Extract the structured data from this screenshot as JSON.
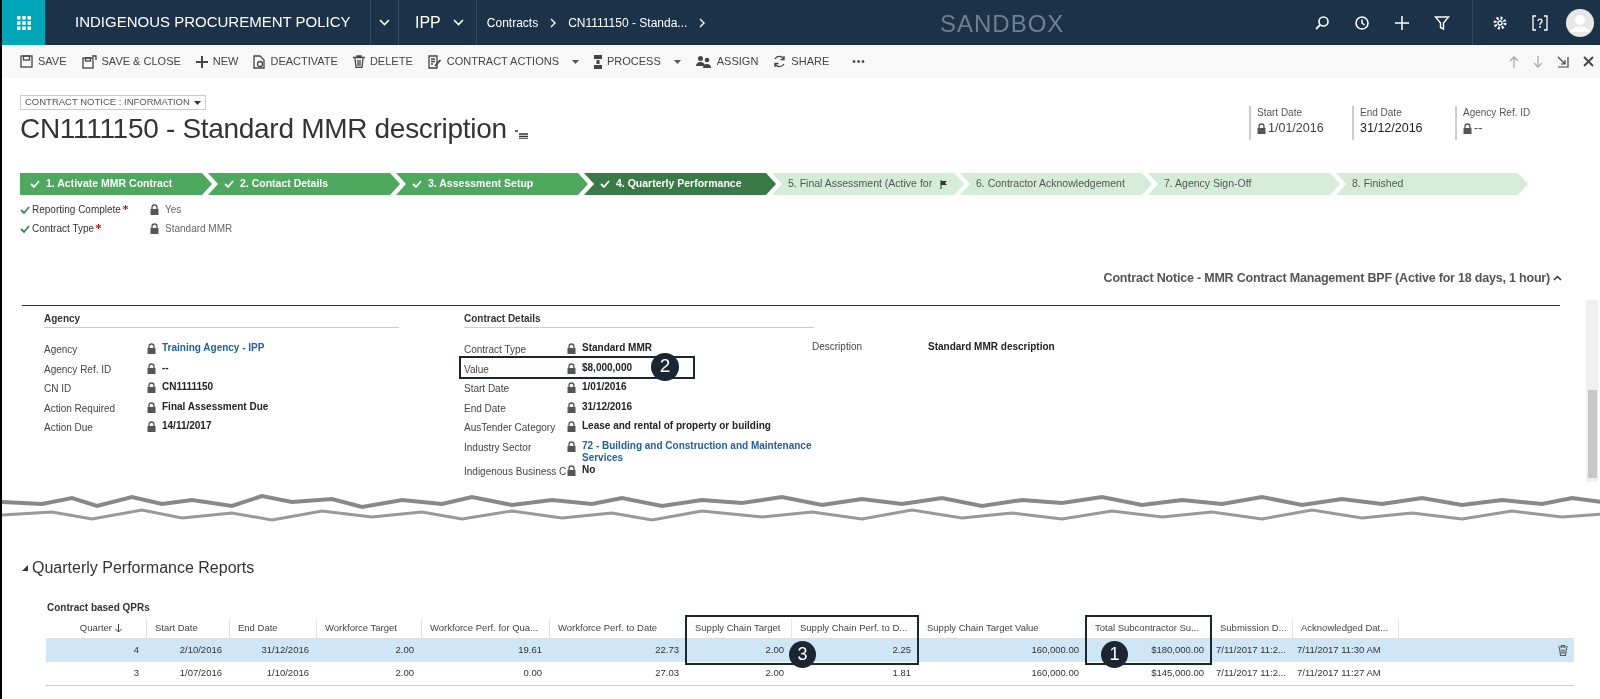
{
  "app": {
    "title": "INDIGENOUS PROCUREMENT POLICY",
    "area": "IPP",
    "breadcrumbs": [
      "Contracts",
      "CN1111150 - Standa..."
    ],
    "environment": "SANDBOX"
  },
  "nav_icons": [
    {
      "kind": "search"
    },
    {
      "kind": "history"
    },
    {
      "kind": "add"
    },
    {
      "kind": "filter"
    },
    {
      "kind": "settings"
    },
    {
      "kind": "help"
    },
    {
      "kind": "avatar"
    }
  ],
  "commands": [
    {
      "label": "SAVE",
      "kind": "save",
      "dropdown": false
    },
    {
      "label": "SAVE & CLOSE",
      "kind": "save-close",
      "dropdown": false
    },
    {
      "label": "NEW",
      "kind": "new",
      "dropdown": false
    },
    {
      "label": "DEACTIVATE",
      "kind": "deactivate",
      "dropdown": false
    },
    {
      "label": "DELETE",
      "kind": "delete",
      "dropdown": false
    },
    {
      "label": "CONTRACT ACTIONS",
      "kind": "actions",
      "dropdown": true
    },
    {
      "label": "PROCESS",
      "kind": "process",
      "dropdown": true
    },
    {
      "label": "ASSIGN",
      "kind": "assign",
      "dropdown": false
    },
    {
      "label": "SHARE",
      "kind": "share",
      "dropdown": false
    },
    {
      "label": "•••",
      "kind": "more",
      "dropdown": false
    }
  ],
  "form_selector": "CONTRACT NOTICE : INFORMATION",
  "record_title": "CN1111150 - Standard MMR description",
  "header_fields": [
    {
      "label": "Start Date",
      "value": "1/01/2016",
      "locked": true
    },
    {
      "label": "End Date",
      "value": "31/12/2016",
      "locked": false
    },
    {
      "label": "Agency Ref. ID",
      "value": "--",
      "locked": true
    }
  ],
  "process_stages": [
    {
      "label": "1. Activate MMR Contract",
      "checked": true,
      "selected": false,
      "flagged": false
    },
    {
      "label": "2. Contact Details",
      "checked": true,
      "selected": false,
      "flagged": false
    },
    {
      "label": "3. Assessment Setup",
      "checked": true,
      "selected": false,
      "flagged": false
    },
    {
      "label": "4. Quarterly Performance",
      "checked": true,
      "selected": true,
      "flagged": false
    },
    {
      "label": "5. Final Assessment (Active for",
      "checked": false,
      "selected": false,
      "flagged": true
    },
    {
      "label": "6. Contractor Acknowledgement",
      "checked": false,
      "selected": false,
      "flagged": false
    },
    {
      "label": "7. Agency Sign-Off",
      "checked": false,
      "selected": false,
      "flagged": false
    },
    {
      "label": "8. Finished",
      "checked": false,
      "selected": false,
      "flagged": false
    }
  ],
  "stage_fields": [
    {
      "label": "Reporting Complete",
      "required": true,
      "done": true,
      "value": "Yes"
    },
    {
      "label": "Contract Type",
      "required": true,
      "done": true,
      "value": "Standard MMR"
    }
  ],
  "process_name": "Contract Notice - MMR Contract Management BPF (Active for 18 days, 1 hour)",
  "sections": [
    {
      "title": "Agency",
      "fields": [
        {
          "label": "Agency",
          "value": "Training Agency - IPP",
          "link": true
        },
        {
          "label": "Agency Ref. ID",
          "value": "--",
          "link": false
        },
        {
          "label": "CN ID",
          "value": "CN1111150",
          "link": false
        },
        {
          "label": "Action Required",
          "value": "Final Assessment Due",
          "link": false
        },
        {
          "label": "Action Due",
          "value": "14/11/2017",
          "link": false
        }
      ]
    },
    {
      "title": "Contract Details",
      "fields": [
        {
          "label": "Contract Type",
          "value": "Standard MMR",
          "link": false
        },
        {
          "label": "Value",
          "value": "$8,000,000",
          "link": false,
          "callout": "2"
        },
        {
          "label": "Start Date",
          "value": "1/01/2016",
          "link": false
        },
        {
          "label": "End Date",
          "value": "31/12/2016",
          "link": false
        },
        {
          "label": "AusTender Category",
          "value": "Lease and rental of property or building",
          "link": false
        },
        {
          "label": "Industry Sector",
          "value": "72 - Building and Construction and Maintenance Services",
          "link": true
        },
        {
          "label": "Indigenous Business C",
          "value": "No",
          "link": false
        }
      ],
      "side_field": {
        "label": "Description",
        "value": "Standard MMR description"
      }
    }
  ],
  "qpr": {
    "section_title": "Quarterly Performance Reports",
    "expanded": true,
    "grid_title": "Contract based QPRs",
    "columns": [
      {
        "label": "Quarter",
        "sorted_descending": true
      },
      {
        "label": "Start Date"
      },
      {
        "label": "End Date"
      },
      {
        "label": "Workforce Target"
      },
      {
        "label": "Workforce Perf. for Qua..."
      },
      {
        "label": "Workforce Perf. to Date"
      },
      {
        "label": "Supply Chain Target",
        "highlighted": true
      },
      {
        "label": "Supply Chain Perf. to D...",
        "highlighted": true
      },
      {
        "label": "Supply Chain Target Value"
      },
      {
        "label": "Total Subcontractor Su...",
        "highlighted": true
      },
      {
        "label": "Submission D..."
      },
      {
        "label": "Acknowledged Dat..."
      }
    ],
    "rows": [
      {
        "selected": true,
        "cells": [
          "4",
          "2/10/2016",
          "31/12/2016",
          "2.00",
          "19.61",
          "22.73",
          "2.00",
          "2.25",
          "160,000.00",
          "$180,000.00",
          "7/11/2017 11:2...",
          "7/11/2017 11:30 AM"
        ]
      },
      {
        "selected": false,
        "cells": [
          "3",
          "1/07/2016",
          "1/10/2016",
          "2.00",
          "0.00",
          "27.03",
          "2.00",
          "1.81",
          "160,000.00",
          "$145,000.00",
          "7/11/2017 11:2...",
          "7/11/2017 11:27 AM"
        ]
      }
    ],
    "callouts": [
      "3",
      "1"
    ]
  }
}
